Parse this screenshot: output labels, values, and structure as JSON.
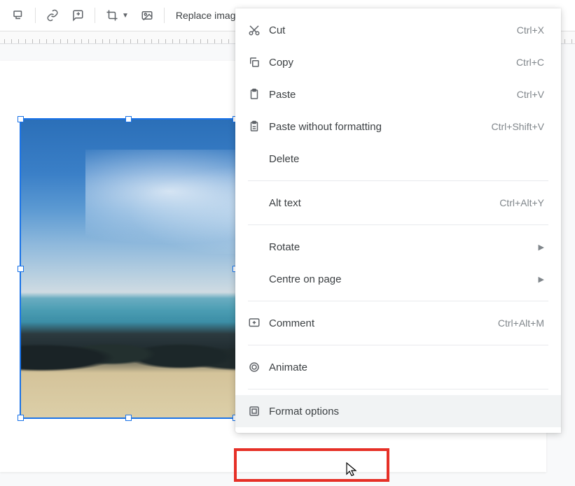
{
  "toolbar": {
    "replace_label": "Replace image"
  },
  "menu": {
    "cut": {
      "label": "Cut",
      "shortcut": "Ctrl+X"
    },
    "copy": {
      "label": "Copy",
      "shortcut": "Ctrl+C"
    },
    "paste": {
      "label": "Paste",
      "shortcut": "Ctrl+V"
    },
    "paste_no_fmt": {
      "label": "Paste without formatting",
      "shortcut": "Ctrl+Shift+V"
    },
    "delete": {
      "label": "Delete"
    },
    "alt_text": {
      "label": "Alt text",
      "shortcut": "Ctrl+Alt+Y"
    },
    "rotate": {
      "label": "Rotate"
    },
    "centre": {
      "label": "Centre on page"
    },
    "comment": {
      "label": "Comment",
      "shortcut": "Ctrl+Alt+M"
    },
    "animate": {
      "label": "Animate"
    },
    "format_options": {
      "label": "Format options"
    }
  }
}
